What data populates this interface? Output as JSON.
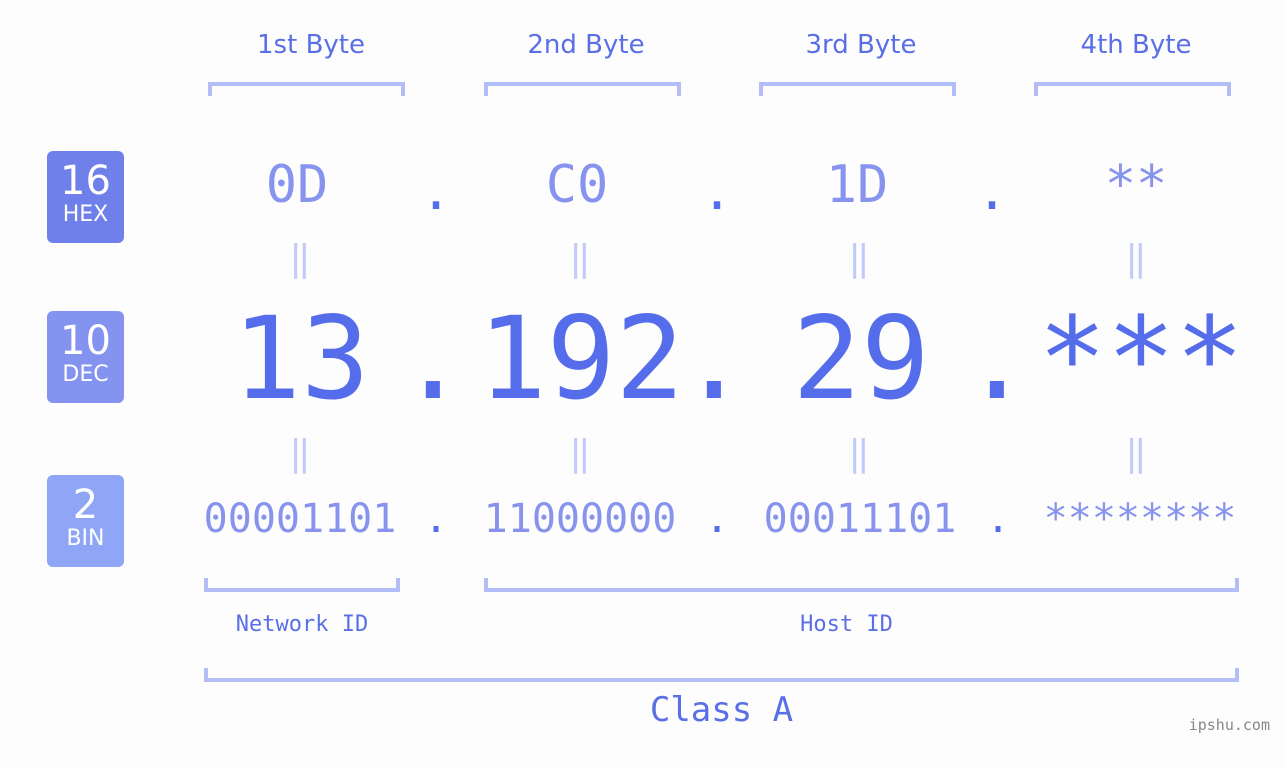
{
  "byte_headers": [
    "1st Byte",
    "2nd Byte",
    "3rd Byte",
    "4th Byte"
  ],
  "badges": [
    {
      "number": "16",
      "label": "HEX",
      "color": "#7080ea"
    },
    {
      "number": "10",
      "label": "DEC",
      "color": "#8493f0"
    },
    {
      "number": "2",
      "label": "BIN",
      "color": "#8fa6f7"
    }
  ],
  "hex": [
    "0D",
    "C0",
    "1D",
    "**"
  ],
  "dec": [
    "13",
    "192",
    "29",
    "***"
  ],
  "bin": [
    "00001101",
    "11000000",
    "00011101",
    "********"
  ],
  "separator": ".",
  "equals": "=",
  "network_id_label": "Network ID",
  "host_id_label": "Host ID",
  "class_label": "Class A",
  "watermark": "ipshu.com",
  "colors": {
    "accent": "#566deb",
    "light": "#8793ee",
    "bracket": "#b3bdf7"
  }
}
